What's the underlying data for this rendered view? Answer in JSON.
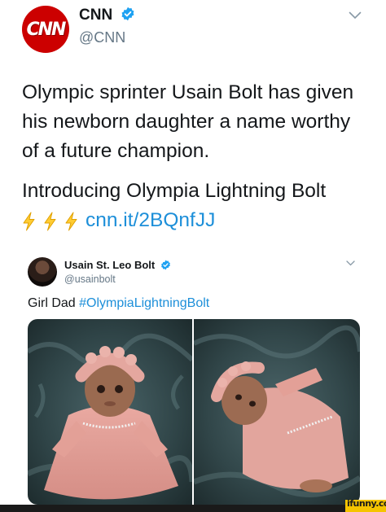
{
  "tweet": {
    "avatar_text": "CNN",
    "display_name": "CNN",
    "handle": "@CNN",
    "text_line1": "Olympic sprinter Usain Bolt has given",
    "text_line2": "his newborn daughter a name worthy",
    "text_line3": "of a future champion.",
    "text_line4": "Introducing Olympia Lightning Bolt",
    "link": "cnn.it/2BQnfJJ",
    "emoji_icon": "lightning-bolt-icon"
  },
  "quoted": {
    "display_name": "Usain St. Leo Bolt",
    "handle": "@usainbolt",
    "text_prefix": "Girl Dad ",
    "hashtag": "#OlympiaLightningBolt"
  },
  "watermark": "ifunny.co",
  "colors": {
    "brand_red": "#cc0000",
    "link_blue": "#1d8fd9",
    "verified_blue": "#1da1f2",
    "secondary_text": "#657786",
    "watermark_yellow": "#f5c400"
  }
}
